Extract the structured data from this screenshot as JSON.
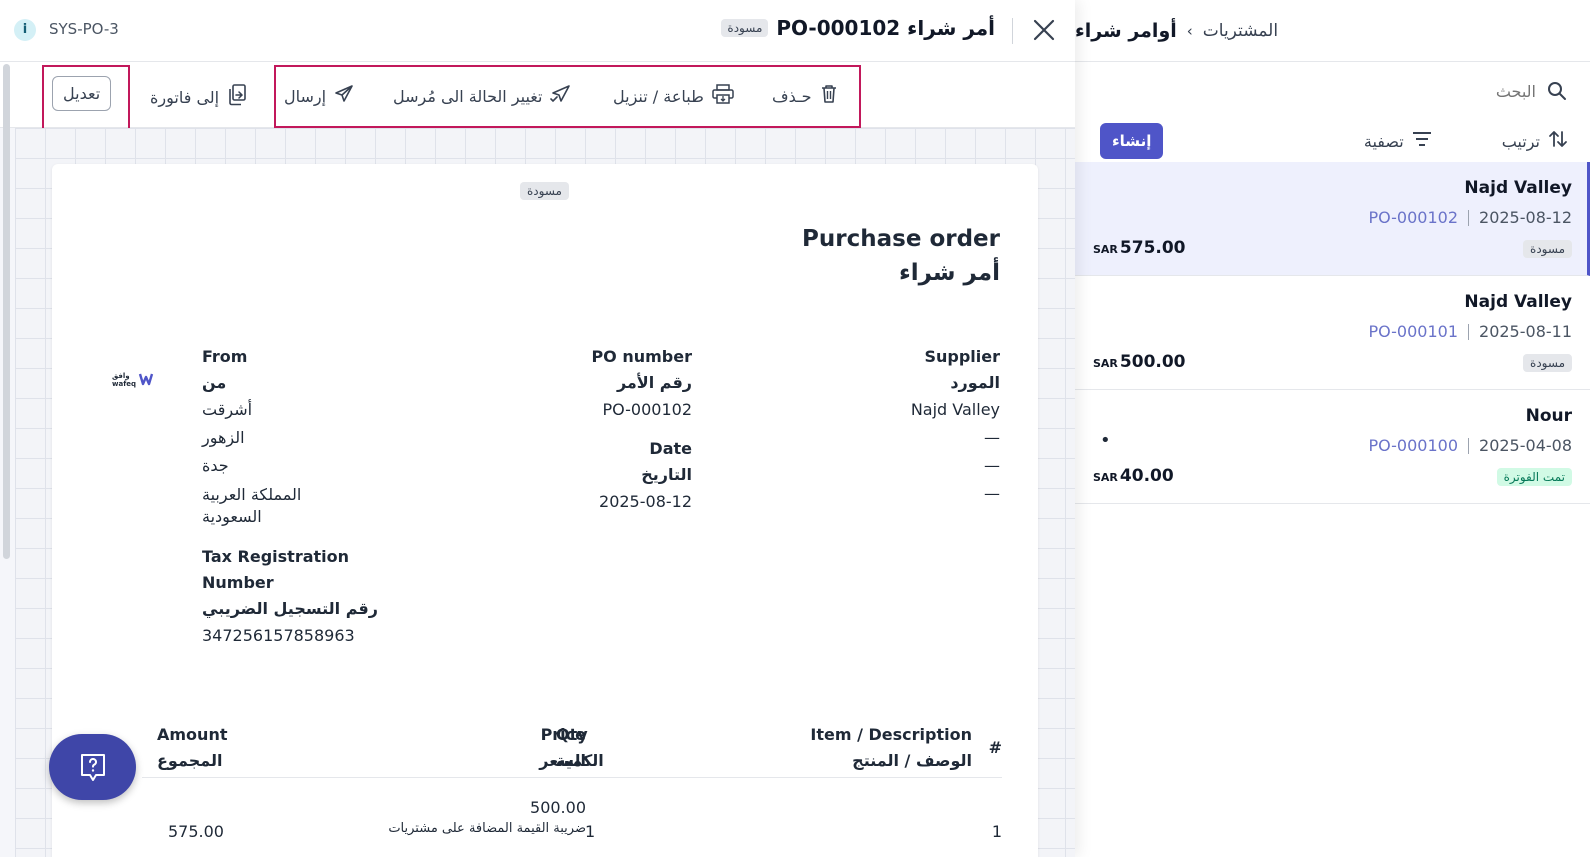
{
  "list": {
    "breadcrumb_parent": "المشتريات",
    "breadcrumb_sep": "›",
    "breadcrumb_current": "أوامر شراء",
    "search_placeholder": "البحث",
    "create_label": "إنشاء",
    "filter_label": "تصفية",
    "sort_label": "ترتيب",
    "items": [
      {
        "supplier": "Najd Valley",
        "date": "2025-08-12",
        "po": "PO-000102",
        "status": "مسودة",
        "amount": "575.00",
        "currency": "SAR"
      },
      {
        "supplier": "Najd Valley",
        "date": "2025-08-11",
        "po": "PO-000101",
        "status": "مسودة",
        "amount": "500.00",
        "currency": "SAR"
      },
      {
        "supplier": "Nour",
        "date": "2025-04-08",
        "po": "PO-000100",
        "status": "تمت الفوترة",
        "amount": "40.00",
        "currency": "SAR",
        "dot": "•"
      }
    ]
  },
  "detail": {
    "sys_code": "SYS-PO-3",
    "info_glyph": "i",
    "title": "أمر شراء PO-000102",
    "title_badge": "مسودة",
    "actions": {
      "delete": "حـذف",
      "print": "طباعة / تنزيل",
      "mark_sent": "تغيير الحالة الى مُرسل",
      "send": "إرسال",
      "to_invoice": "إلى فاتورة",
      "edit": "تعديل"
    },
    "paper": {
      "badge": "مسودة",
      "title_en": "Purchase order",
      "title_ar": "أمر شراء",
      "supplier_label_en": "Supplier",
      "supplier_label_ar": "المورد",
      "supplier_name": "Najd Valley",
      "dash": "—",
      "po_label_en": "PO number",
      "po_label_ar": "رقم الأمر",
      "po_value": "PO-000102",
      "date_label_en": "Date",
      "date_label_ar": "التاريخ",
      "date_value": "2025-08-12",
      "from_label_en": "From",
      "from_label_ar": "من",
      "from_lines": [
        "أشرقت",
        "الزهور",
        "جدة",
        "المملكة العربية",
        "السعودية"
      ],
      "tax_label_en_1": "Tax Registration",
      "tax_label_en_2": "Number",
      "tax_label_ar": "رقم التسجيل الضريبي",
      "tax_value": "347256157858963",
      "logo_text": "وافق wafeq",
      "table": {
        "hash": "#",
        "item_en": "Item / Description",
        "item_ar": "الوصف / المنتج",
        "qty_en": "Qty",
        "qty_ar": "الكمية",
        "price_en": "Price",
        "price_ar": "السعر",
        "amount_en": "Amount",
        "amount_ar": "المجموع",
        "rows": [
          {
            "num": "1",
            "qty": "1",
            "price": "500.00",
            "tax_note": "ضريبة القيمة المضافة على مشتريات",
            "amount": "575.00"
          }
        ]
      }
    }
  },
  "colors": {
    "accent": "#4f55c8",
    "highlight_border": "#c2185b",
    "fab": "#3f46a8"
  }
}
